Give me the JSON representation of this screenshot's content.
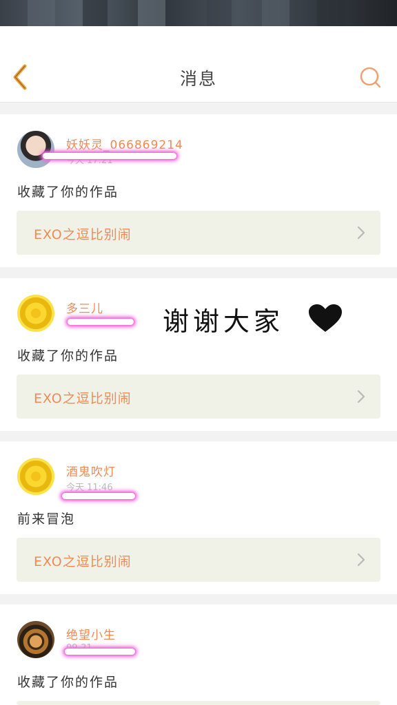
{
  "header": {
    "title": "消息",
    "back_icon": "chevron-left-icon",
    "search_icon": "search-icon",
    "accent_color": "#f08a55"
  },
  "overlay": {
    "thanks_text": "谢谢大家",
    "heart_icon": "heart-icon"
  },
  "messages": [
    {
      "username": "妖妖灵_066869214",
      "timestamp": "今天 17:21",
      "action": "收藏了你的作品",
      "work_title": "EXO之逗比别闹"
    },
    {
      "username": "多三儿",
      "timestamp": "",
      "action": "收藏了你的作品",
      "work_title": "EXO之逗比别闹"
    },
    {
      "username": "酒鬼吹灯",
      "timestamp": "今天 11:46",
      "action": "前来冒泡",
      "work_title": "EXO之逗比别闹"
    },
    {
      "username": "绝望小生",
      "timestamp": "09-21",
      "action": "收藏了你的作品",
      "work_title": ""
    }
  ]
}
